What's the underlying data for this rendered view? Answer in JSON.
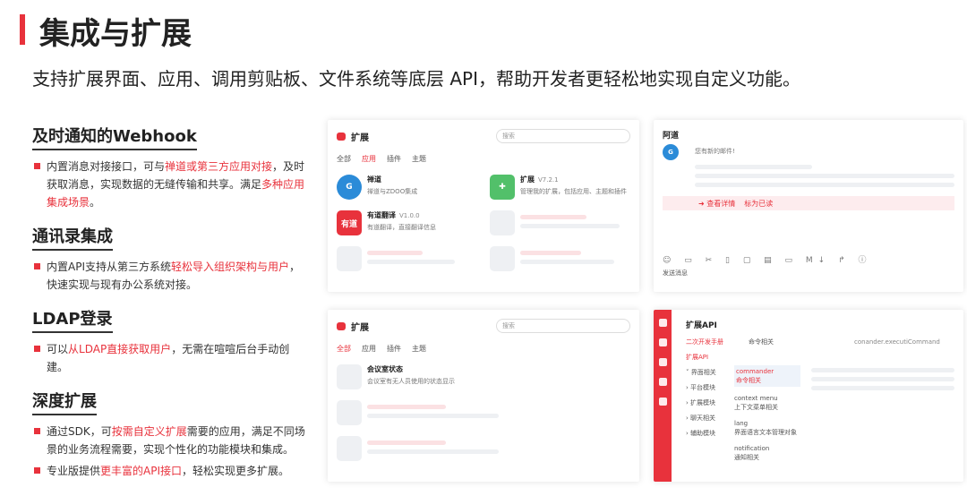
{
  "page": {
    "title": "集成与扩展",
    "subtitle": "支持扩展界面、应用、调用剪贴板、文件系统等底层 API，帮助开发者更轻松地实现自定义功能。"
  },
  "features": [
    {
      "heading": "及时通知的Webhook",
      "bullets": [
        [
          "内置消息对接接口，可与",
          "禅道或第三方应用对接",
          "，及时获取消息，实现数据的无缝传输和共享。满足",
          "多种应用集成场景",
          "。"
        ]
      ]
    },
    {
      "heading": "通讯录集成",
      "bullets": [
        [
          "内置API支持从第三方系统",
          "轻松导入组织架构与用户",
          "，快速实现与现有办公系统对接。",
          "",
          ""
        ]
      ]
    },
    {
      "heading": "LDAP登录",
      "bullets": [
        [
          "可以",
          "从LDAP直接获取用户",
          "，无需在喧喧后台手动创建。",
          "",
          ""
        ]
      ]
    },
    {
      "heading": "深度扩展",
      "bullets": [
        [
          "通过SDK，可",
          "按需自定义扩展",
          "需要的应用，满足不同场景的业务流程需要，实现个性化的功能模块和集成。",
          "",
          ""
        ],
        [
          "专业版提供",
          "更丰富的API接口",
          "，轻松实现更多扩展。",
          "",
          ""
        ]
      ]
    }
  ],
  "panel1": {
    "title": "扩展",
    "search_placeholder": "搜索",
    "tabs": [
      "全部",
      "应用",
      "插件",
      "主题"
    ],
    "cards": [
      {
        "name": "禅道",
        "version": "",
        "desc": "禅道与ZDOO集成"
      },
      {
        "name": "扩展",
        "version": "V7.2.1",
        "desc": "管理我的扩展，包括应用、主题和插件"
      },
      {
        "name": "有道翻译",
        "version": "V1.0.0",
        "desc": "有道翻译，直接翻译信息",
        "icon_text": "有道"
      }
    ]
  },
  "panel2": {
    "sender": "阿道",
    "message": "您有新的邮件!",
    "view_label": "查看详情",
    "mark_label": "标为已读",
    "toolbar": "☺ ▭ ✂ ▯ ▢ ▤ ▭ M↓ ↱ ⓘ",
    "send_label": "发送消息"
  },
  "panel3": {
    "title": "扩展",
    "search_placeholder": "搜索",
    "tabs": [
      "全部",
      "应用",
      "插件",
      "主题"
    ],
    "item_name": "会议室状态",
    "item_desc": "会议室有无人员使用的状态显示"
  },
  "panel4": {
    "title": "扩展API",
    "nav": [
      "二次开发手册",
      "扩展API"
    ],
    "tree": [
      "界面相关",
      "平台模块",
      "扩展模块",
      "聊天相关",
      "辅助模块"
    ],
    "col2_head": "命令相关",
    "col3_head": "conander.executiCommand",
    "entries": [
      {
        "name": "commander",
        "desc": "命令相关"
      },
      {
        "name": "context menu",
        "desc": "上下文菜单相关"
      },
      {
        "name": "lang",
        "desc": "界面语言文本管理对象"
      },
      {
        "name": "notification",
        "desc": "通知相关"
      }
    ]
  }
}
